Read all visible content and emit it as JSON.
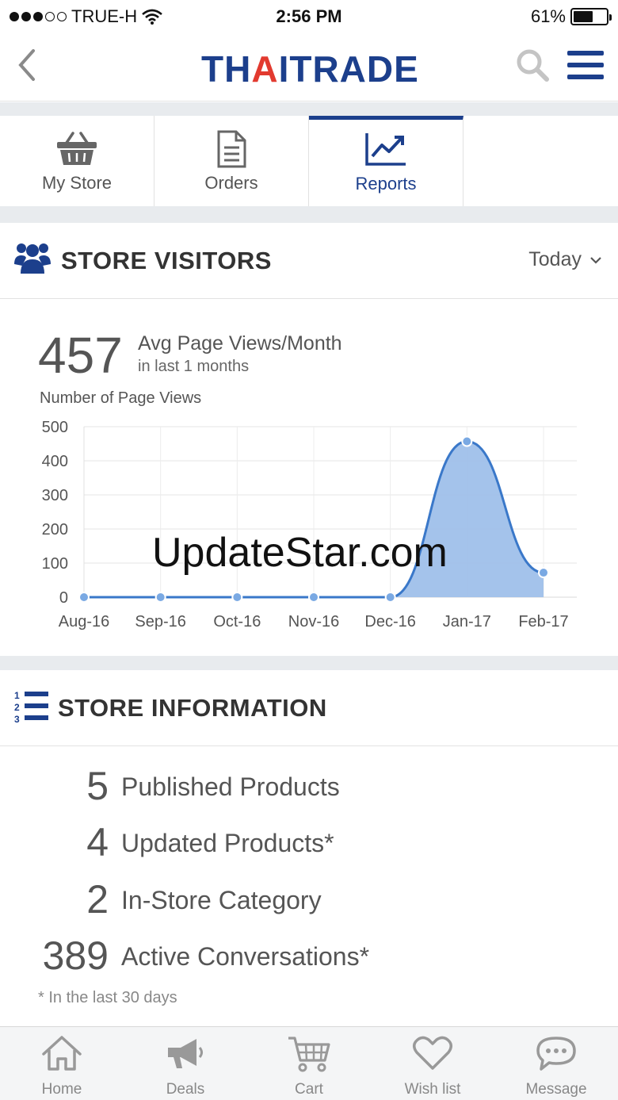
{
  "status_bar": {
    "carrier": "TRUE-H",
    "time": "2:56 PM",
    "battery": "61%",
    "battery_level": 0.61
  },
  "header": {
    "logo_part1": "TH",
    "logo_part2": "A",
    "logo_part3": "ITRADE",
    "brand_color": "#1c3f8c",
    "accent_color": "#e23a2f"
  },
  "tabs": [
    {
      "label": "My Store",
      "icon": "basket-icon",
      "active": false
    },
    {
      "label": "Orders",
      "icon": "document-icon",
      "active": false
    },
    {
      "label": "Reports",
      "icon": "chart-line-icon",
      "active": true
    }
  ],
  "visitors": {
    "title": "STORE VISITORS",
    "range": "Today",
    "big_number": "457",
    "avg_label": "Avg Page Views/Month",
    "avg_sub": "in last 1 months",
    "chart_title": "Number of Page Views",
    "watermark": "UpdateStar.com"
  },
  "chart_data": {
    "type": "area",
    "title": "Number of Page Views",
    "categories": [
      "Aug-16",
      "Sep-16",
      "Oct-16",
      "Nov-16",
      "Dec-16",
      "Jan-17",
      "Feb-17"
    ],
    "values": [
      0,
      0,
      0,
      0,
      0,
      457,
      72
    ],
    "y_ticks": [
      "0",
      "100",
      "200",
      "300",
      "400",
      "500"
    ],
    "ylim": [
      0,
      500
    ],
    "grid": true,
    "series_color": "#3a78c9",
    "fill_color": "#9fc0ea"
  },
  "store_info": {
    "title": "STORE INFORMATION",
    "rows": [
      {
        "num": "5",
        "label": "Published Products"
      },
      {
        "num": "4",
        "label": "Updated Products*"
      },
      {
        "num": "2",
        "label": "In-Store Category"
      },
      {
        "num": "389",
        "label": "Active Conversations*"
      }
    ],
    "footnote": "* In the last 30 days"
  },
  "bottom_bar": [
    {
      "label": "Home",
      "icon": "home-icon"
    },
    {
      "label": "Deals",
      "icon": "megaphone-icon"
    },
    {
      "label": "Cart",
      "icon": "cart-icon"
    },
    {
      "label": "Wish list",
      "icon": "heart-icon"
    },
    {
      "label": "Message",
      "icon": "chat-icon"
    }
  ]
}
